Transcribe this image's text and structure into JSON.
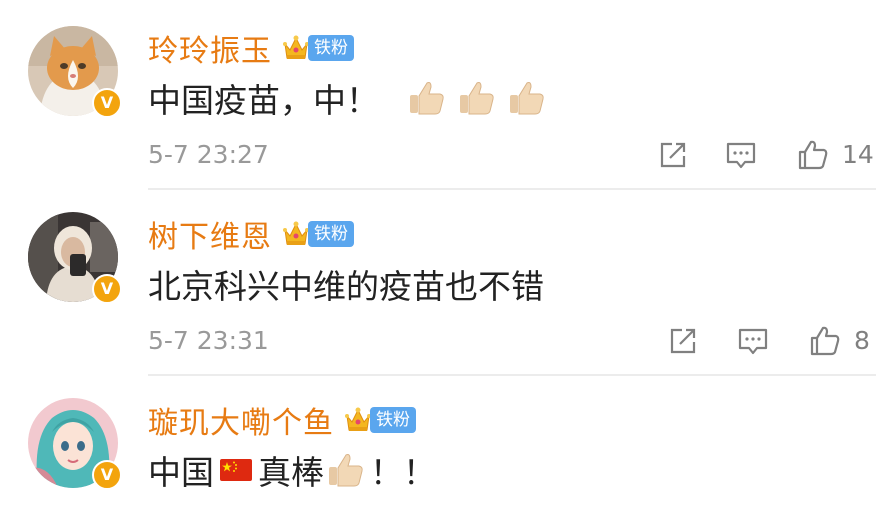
{
  "comments": [
    {
      "username": "玲玲振玉",
      "fan_badge": "铁粉",
      "content_text": "中国疫苗，中！",
      "timestamp": "5-7 23:27",
      "like_count": "14",
      "avatar": "cat-avatar",
      "verified": "V"
    },
    {
      "username": "树下维恩",
      "fan_badge": "铁粉",
      "content_text": "北京科兴中维的疫苗也不错",
      "timestamp": "5-7 23:31",
      "like_count": "8",
      "avatar": "selfie-avatar",
      "verified": "V"
    },
    {
      "username": "璇玑大嘞个鱼",
      "fan_badge": "铁粉",
      "content_text_before": "中国",
      "content_text_after": "真棒",
      "content_text_end": "！！",
      "avatar": "anime-girl-avatar",
      "verified": "V"
    }
  ],
  "colors": {
    "username": "#e77b13",
    "fan_badge": "#5aa6ee",
    "verified_badge": "#f3a40d",
    "meta": "#999999"
  },
  "icons": [
    "share-icon",
    "comment-icon",
    "like-icon",
    "thumbs-up-emoji",
    "china-flag-emoji",
    "crown-icon"
  ]
}
